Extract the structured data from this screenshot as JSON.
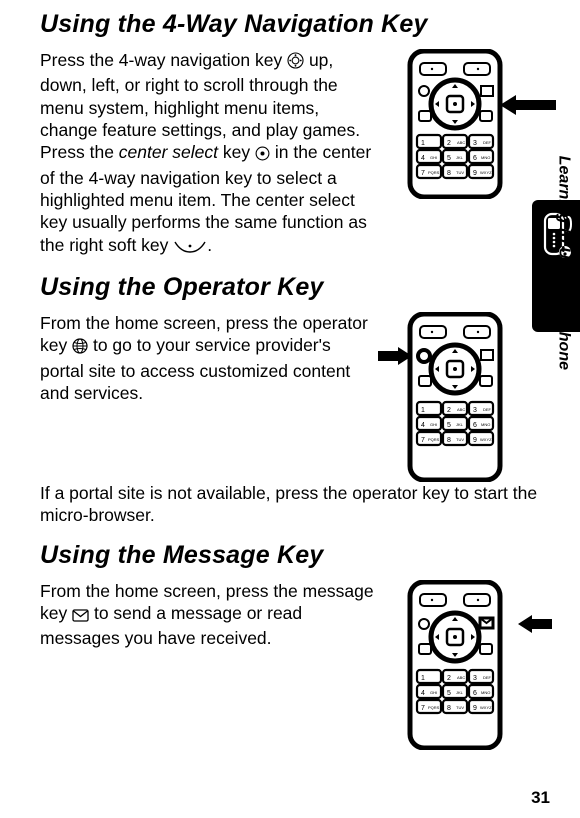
{
  "sections": {
    "s1": {
      "heading": "Using the 4-Way Navigation Key",
      "p1a": "Press the 4-way navigation key ",
      "p1b": " up, down, left, or right to scroll through the menu system, highlight menu items, change feature settings, and play games. Press the ",
      "kw1": "center select",
      "p1c": " key ",
      "p1d": " in the center of the 4-way navigation key to select a highlighted menu item. The center select key usually performs the same function as the right soft key ",
      "p1e": "."
    },
    "s2": {
      "heading": "Using the Operator Key",
      "p1a": "From the home screen, press the operator key ",
      "p1b": " to go to your service provider's portal site to access customized content and services.",
      "p2": "If a portal site is not available, press the operator key to start the micro-browser."
    },
    "s3": {
      "heading": "Using the Message Key",
      "p1a": "From the home screen, press the message key ",
      "p1b": " to send a message or read messages you have received."
    }
  },
  "sideLabel": "Learning to Use Your Phone",
  "pageNumber": "31",
  "icons": {
    "navRing": "nav-ring-icon",
    "centerDot": "center-dot-icon",
    "softkey": "softkey-icon",
    "globe": "globe-icon",
    "envelope": "envelope-icon",
    "phoneTab": "phone-tab-icon"
  }
}
